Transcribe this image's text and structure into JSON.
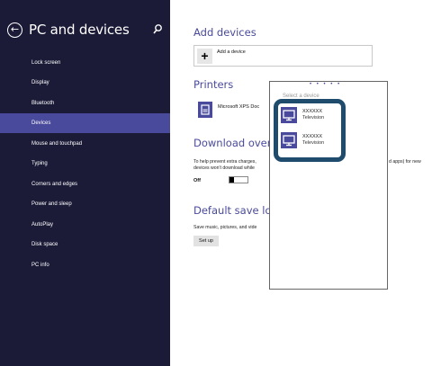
{
  "sidebar": {
    "title": "PC and devices",
    "items": [
      {
        "label": "Lock screen"
      },
      {
        "label": "Display"
      },
      {
        "label": "Bluetooth"
      },
      {
        "label": "Devices"
      },
      {
        "label": "Mouse and touchpad"
      },
      {
        "label": "Typing"
      },
      {
        "label": "Corners and edges"
      },
      {
        "label": "Power and sleep"
      },
      {
        "label": "AutoPlay"
      },
      {
        "label": "Disk space"
      },
      {
        "label": "PC info"
      }
    ],
    "active_index": 3
  },
  "main": {
    "add_devices": {
      "title": "Add devices",
      "button_label": "Add a device"
    },
    "printers": {
      "title": "Printers",
      "printer_name": "Microsoft XPS Doc"
    },
    "download": {
      "title": "Download over",
      "text_line1": "To help prevent extra charges,",
      "text_line2": "devices won't download while",
      "text_right": "d apps) for new",
      "toggle_state": "Off"
    },
    "default_save": {
      "title": "Default save loca",
      "text": "Save music, pictures, and vide",
      "button_label": "Set up"
    }
  },
  "flyout": {
    "dots": "• • • • •",
    "title": "Select a device",
    "devices": [
      {
        "name": "XXXXXX",
        "type": "Television"
      },
      {
        "name": "XXXXXX",
        "type": "Television"
      }
    ]
  },
  "colors": {
    "sidebar_bg": "#1b1b38",
    "accent": "#4a4a9c",
    "highlight_frame": "#1f4b6d"
  },
  "icons": {
    "back": "back-arrow-icon",
    "search": "search-icon",
    "add": "plus-icon",
    "printer": "printer-icon",
    "device": "tv-monitor-icon"
  }
}
